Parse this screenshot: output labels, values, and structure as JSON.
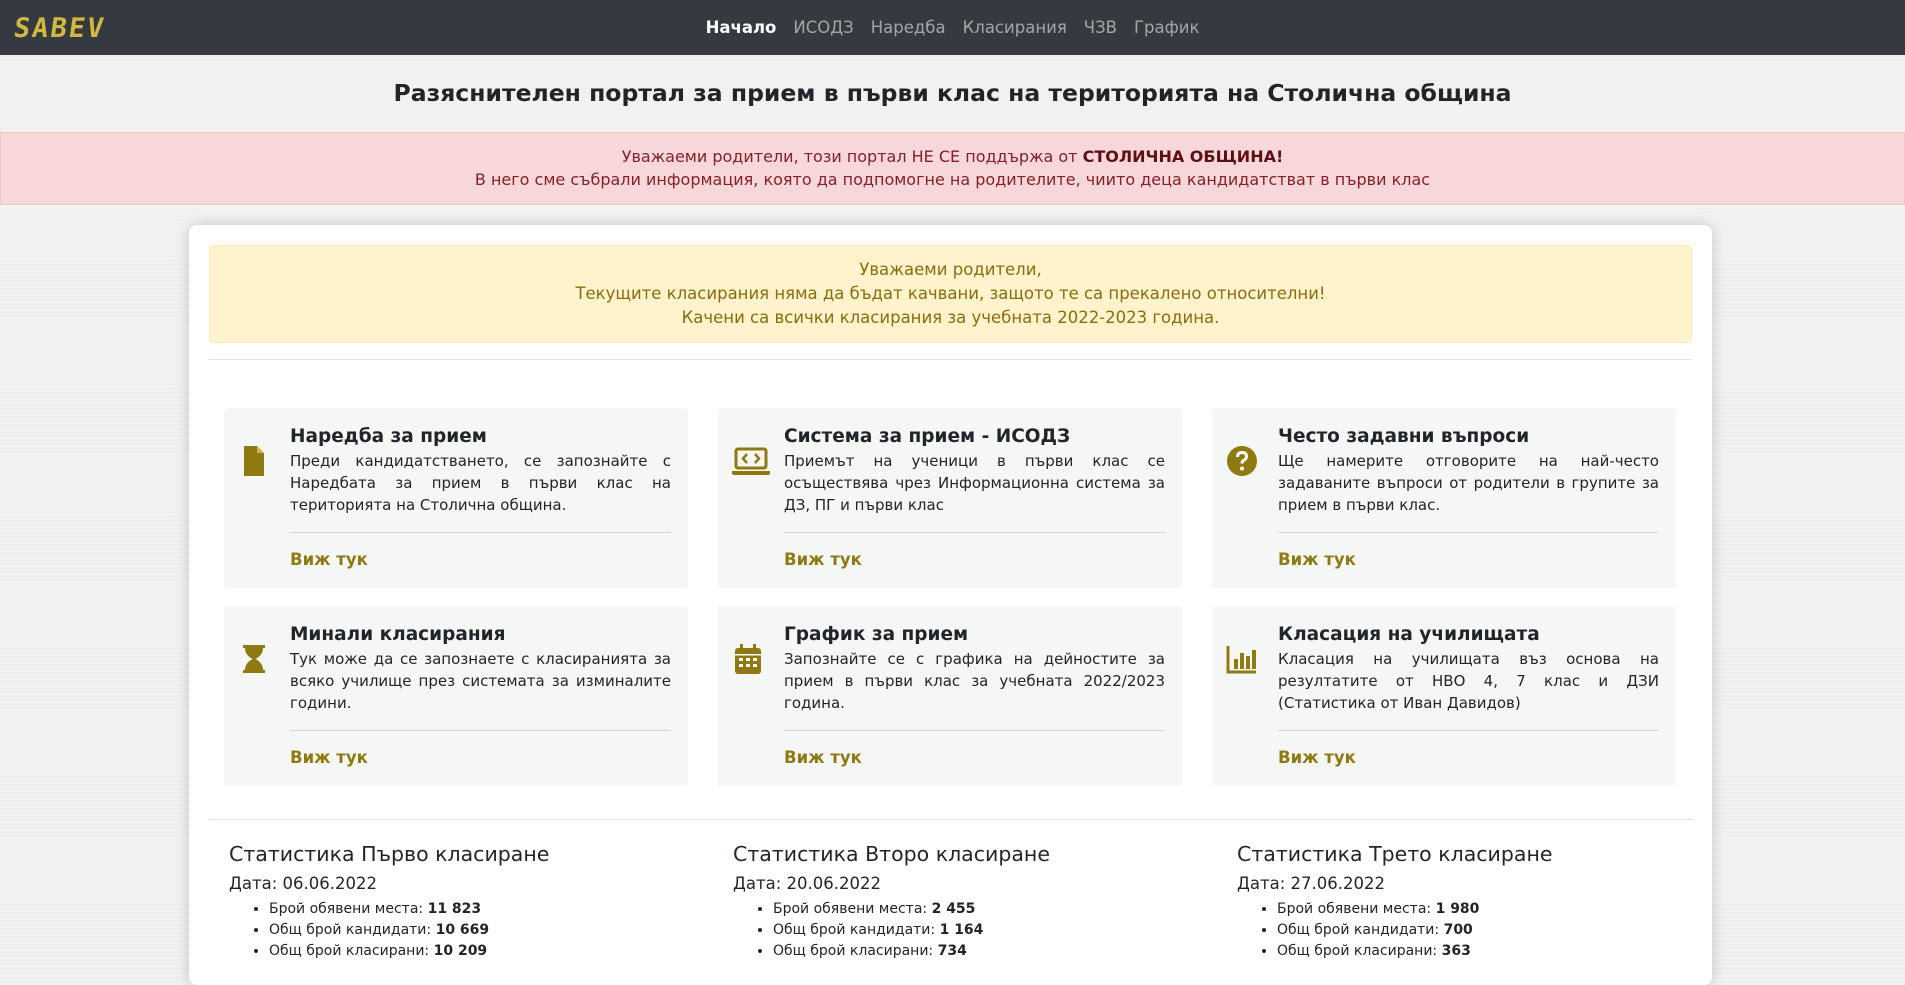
{
  "brand": {
    "logo": "SABEV",
    "accent": "#8e7a10"
  },
  "nav": {
    "items": [
      {
        "label": "Начало",
        "active": true
      },
      {
        "label": "ИСОДЗ"
      },
      {
        "label": "Наредба"
      },
      {
        "label": "Класирания"
      },
      {
        "label": "ЧЗВ"
      },
      {
        "label": "График"
      }
    ]
  },
  "page_title": "Разяснителен портал за прием в първи клас на територията на Столична община",
  "disclaimer": {
    "line1_prefix": "Уважаеми родители, този портал НЕ СЕ поддържа от ",
    "line1_bold": "СТОЛИЧНА ОБЩИНА!",
    "line2": "В него сме събрали информация, която да подпомогне на родителите, чиито деца кандидатстват в първи клас"
  },
  "notice": {
    "line1": "Уважаеми родители,",
    "line2": "Текущите класирания няма да бъдат качвани, защото те са прекалено относителни!",
    "line3": "Качени са всички класирания за учебната 2022-2023 година."
  },
  "cards": [
    {
      "icon": "file-icon",
      "title": "Наредба за прием",
      "text": "Преди кандидатстването, се запознайте с Наредбата за прием в първи клас на територията на Столична община.",
      "link": "Виж тук"
    },
    {
      "icon": "laptop-code-icon",
      "title": "Система за прием - ИСОДЗ",
      "text": "Приемът на ученици в първи клас се осъществява чрез Информационна система за ДЗ, ПГ и първи клас",
      "link": "Виж тук"
    },
    {
      "icon": "question-circle-icon",
      "title": "Често задавни въпроси",
      "text": "Ще намерите отговорите на най-често задаваните въпроси от родители в групите за прием в първи клас.",
      "link": "Виж тук"
    },
    {
      "icon": "hourglass-icon",
      "title": "Минали класирания",
      "text": "Тук може да се запознаете с класиранията за всяко училище през системата за изминалите години.",
      "link": "Виж тук"
    },
    {
      "icon": "calendar-icon",
      "title": "График за прием",
      "text": "Запознайте се с графика на дейностите за прием в първи клас за учебната 2022/2023 година.",
      "link": "Виж тук"
    },
    {
      "icon": "bar-chart-icon",
      "title": "Класация на училищата",
      "text": "Класация на училищата въз основа на резултатите от НВО 4, 7 клас и ДЗИ (Статистика от Иван Давидов)",
      "link": "Виж тук"
    }
  ],
  "stats": [
    {
      "title": "Статистика Първо класиране",
      "date": "Дата: 06.06.2022",
      "items": [
        {
          "label": "Брой обявени места: ",
          "value": "11 823"
        },
        {
          "label": "Общ брой кандидати: ",
          "value": "10 669"
        },
        {
          "label": "Общ брой класирани: ",
          "value": "10 209"
        }
      ]
    },
    {
      "title": "Статистика Второ класиране",
      "date": "Дата: 20.06.2022",
      "items": [
        {
          "label": "Брой обявени места: ",
          "value": "2 455"
        },
        {
          "label": "Общ брой кандидати: ",
          "value": "1 164"
        },
        {
          "label": "Общ брой класирани: ",
          "value": "734"
        }
      ]
    },
    {
      "title": "Статистика Трето класиране",
      "date": "Дата: 27.06.2022",
      "items": [
        {
          "label": "Брой обявени места: ",
          "value": "1 980"
        },
        {
          "label": "Общ брой кандидати: ",
          "value": "700"
        },
        {
          "label": "Общ брой класирани: ",
          "value": "363"
        }
      ]
    }
  ]
}
